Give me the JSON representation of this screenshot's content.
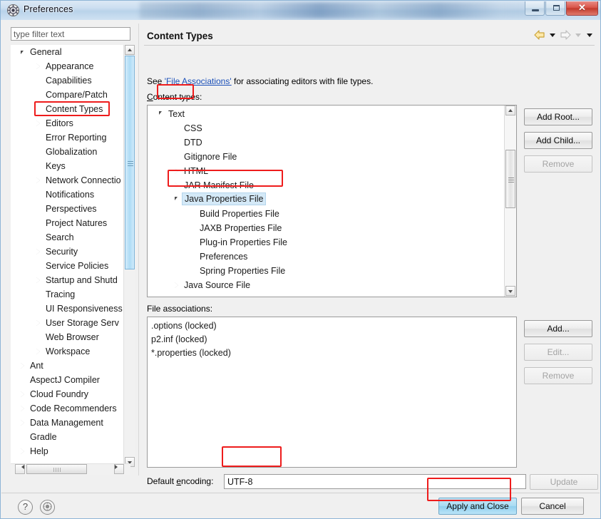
{
  "window": {
    "title": "Preferences",
    "icon": "preferences-gear-icon",
    "buttons": {
      "minimize": "minimize-icon",
      "maximize": "maximize-icon",
      "close": "✕"
    }
  },
  "sidebar": {
    "filter_placeholder": "type filter text",
    "filter_value": "",
    "items": [
      {
        "label": "General",
        "depth": 0,
        "arrow": "expanded",
        "selected": false
      },
      {
        "label": "Appearance",
        "depth": 1,
        "arrow": "collapsed",
        "selected": false
      },
      {
        "label": "Capabilities",
        "depth": 1,
        "arrow": "none",
        "selected": false
      },
      {
        "label": "Compare/Patch",
        "depth": 1,
        "arrow": "none",
        "selected": false
      },
      {
        "label": "Content Types",
        "depth": 1,
        "arrow": "none",
        "selected": true
      },
      {
        "label": "Editors",
        "depth": 1,
        "arrow": "collapsed",
        "selected": false
      },
      {
        "label": "Error Reporting",
        "depth": 1,
        "arrow": "none",
        "selected": false
      },
      {
        "label": "Globalization",
        "depth": 1,
        "arrow": "none",
        "selected": false
      },
      {
        "label": "Keys",
        "depth": 1,
        "arrow": "none",
        "selected": false
      },
      {
        "label": "Network Connectio",
        "depth": 1,
        "arrow": "collapsed",
        "selected": false
      },
      {
        "label": "Notifications",
        "depth": 1,
        "arrow": "none",
        "selected": false
      },
      {
        "label": "Perspectives",
        "depth": 1,
        "arrow": "none",
        "selected": false
      },
      {
        "label": "Project Natures",
        "depth": 1,
        "arrow": "none",
        "selected": false
      },
      {
        "label": "Search",
        "depth": 1,
        "arrow": "none",
        "selected": false
      },
      {
        "label": "Security",
        "depth": 1,
        "arrow": "collapsed",
        "selected": false
      },
      {
        "label": "Service Policies",
        "depth": 1,
        "arrow": "none",
        "selected": false
      },
      {
        "label": "Startup and Shutd",
        "depth": 1,
        "arrow": "collapsed",
        "selected": false
      },
      {
        "label": "Tracing",
        "depth": 1,
        "arrow": "none",
        "selected": false
      },
      {
        "label": "UI Responsiveness",
        "depth": 1,
        "arrow": "none",
        "selected": false
      },
      {
        "label": "User Storage Serv",
        "depth": 1,
        "arrow": "collapsed",
        "selected": false
      },
      {
        "label": "Web Browser",
        "depth": 1,
        "arrow": "none",
        "selected": false
      },
      {
        "label": "Workspace",
        "depth": 1,
        "arrow": "collapsed",
        "selected": false
      },
      {
        "label": "Ant",
        "depth": 0,
        "arrow": "collapsed",
        "selected": false
      },
      {
        "label": "AspectJ Compiler",
        "depth": 0,
        "arrow": "none",
        "selected": false
      },
      {
        "label": "Cloud Foundry",
        "depth": 0,
        "arrow": "collapsed",
        "selected": false
      },
      {
        "label": "Code Recommenders",
        "depth": 0,
        "arrow": "collapsed",
        "selected": false
      },
      {
        "label": "Data Management",
        "depth": 0,
        "arrow": "collapsed",
        "selected": false
      },
      {
        "label": "Gradle",
        "depth": 0,
        "arrow": "none",
        "selected": false
      },
      {
        "label": "Help",
        "depth": 0,
        "arrow": "collapsed",
        "selected": false
      }
    ]
  },
  "page": {
    "title": "Content Types",
    "nav": {
      "back": "back-arrow-icon",
      "back_menu": "chevron-down-icon",
      "forward": "forward-arrow-icon",
      "forward_menu": "chevron-down-icon",
      "menu": "chevron-down-icon"
    },
    "see_prefix": "See ",
    "see_link": "'File Associations'",
    "see_suffix": " for associating editors with file types.",
    "content_types_label": "Content types:",
    "content_types": [
      {
        "label": "Text",
        "depth": 0,
        "arrow": "expanded",
        "selected": false
      },
      {
        "label": "CSS",
        "depth": 1,
        "arrow": "none",
        "selected": false
      },
      {
        "label": "DTD",
        "depth": 1,
        "arrow": "none",
        "selected": false
      },
      {
        "label": "Gitignore File",
        "depth": 1,
        "arrow": "none",
        "selected": false
      },
      {
        "label": "HTML",
        "depth": 1,
        "arrow": "collapsed",
        "selected": false
      },
      {
        "label": "JAR Manifest File",
        "depth": 1,
        "arrow": "collapsed",
        "selected": false
      },
      {
        "label": "Java Properties File",
        "depth": 1,
        "arrow": "expanded",
        "selected": true
      },
      {
        "label": "Build Properties File",
        "depth": 2,
        "arrow": "none",
        "selected": false
      },
      {
        "label": "JAXB Properties File",
        "depth": 2,
        "arrow": "none",
        "selected": false
      },
      {
        "label": "Plug-in Properties File",
        "depth": 2,
        "arrow": "none",
        "selected": false
      },
      {
        "label": "Preferences",
        "depth": 2,
        "arrow": "none",
        "selected": false
      },
      {
        "label": "Spring Properties File",
        "depth": 2,
        "arrow": "none",
        "selected": false
      },
      {
        "label": "Java Source File",
        "depth": 1,
        "arrow": "collapsed",
        "selected": false
      }
    ],
    "tree_buttons": {
      "add_root": "Add Root...",
      "add_child": "Add Child...",
      "remove": "Remove"
    },
    "file_associations_label": "File associations:",
    "file_associations": [
      ".options (locked)",
      "p2.inf (locked)",
      "*.properties (locked)"
    ],
    "assoc_buttons": {
      "add": "Add...",
      "edit": "Edit...",
      "remove": "Remove"
    },
    "default_encoding_label": "Default encoding:",
    "default_encoding_value": "UTF-8",
    "update_button": "Update"
  },
  "footer": {
    "help": "?",
    "settings_icon": "gear-circle-icon",
    "apply_and_close": "Apply and Close",
    "cancel": "Cancel"
  },
  "annotations": {
    "highlight_color": "#ee1c1c",
    "boxes": [
      "sidebar-content-types",
      "content-type-text",
      "content-type-java-properties-file",
      "default-encoding-value",
      "apply-and-close-button"
    ]
  }
}
